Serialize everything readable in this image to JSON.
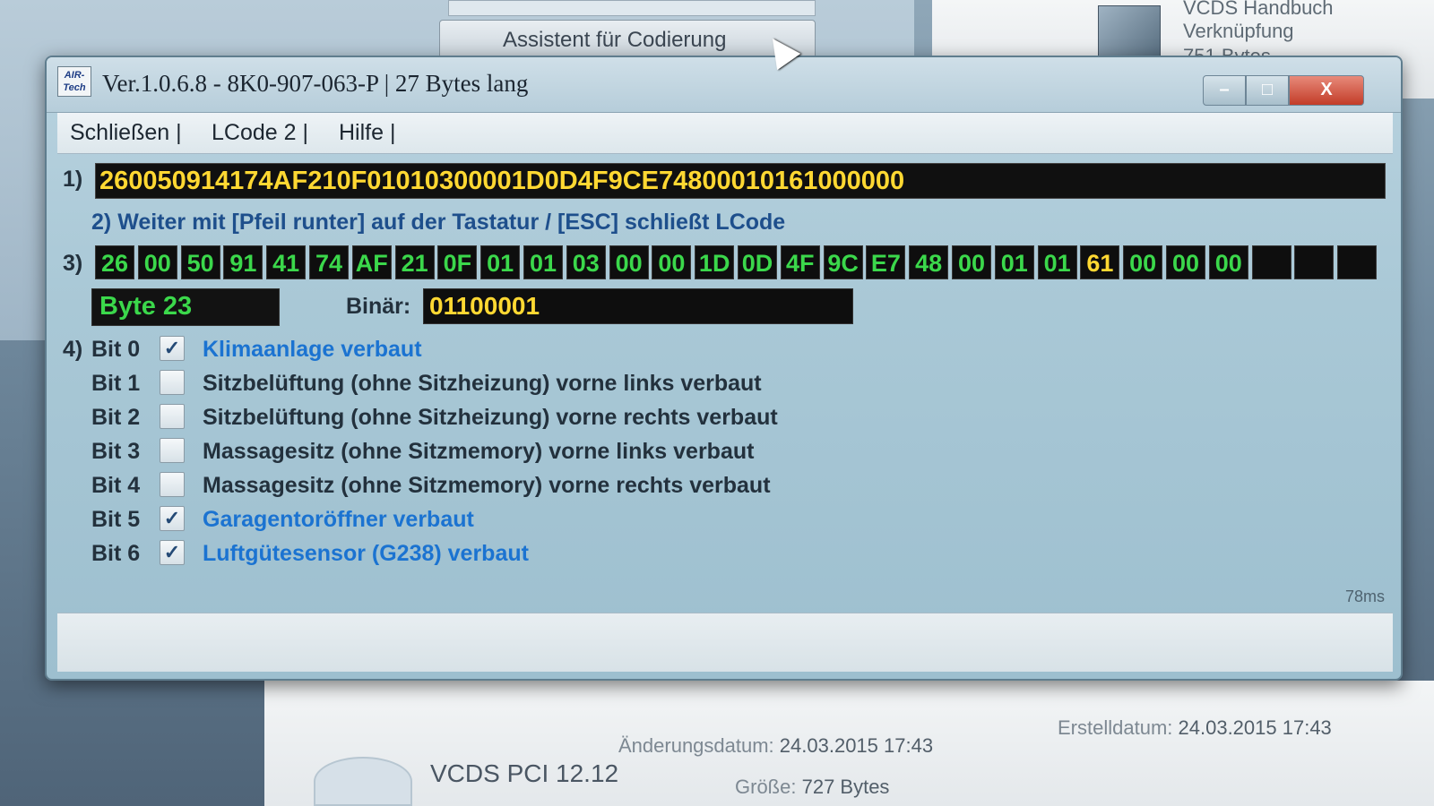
{
  "background": {
    "left_field_text": "Assistent für Codierung",
    "right_texts": [
      "VCDS Handbuch",
      "Verknüpfung",
      "751 Bytes"
    ],
    "bottom_title": "VCDS PCI 12.12",
    "bottom_change_label": "Änderungsdatum:",
    "bottom_change_value": "24.03.2015 17:43",
    "bottom_create_label": "Erstelldatum:",
    "bottom_create_value": "24.03.2015 17:43",
    "bottom_size_label": "Größe:",
    "bottom_size_value": "727 Bytes"
  },
  "window": {
    "icon_text": "AIR-Tech",
    "title": "Ver.1.0.6.8 -   8K0-907-063-P | 27 Bytes lang",
    "minimize": "–",
    "maximize": "□",
    "close": "X"
  },
  "menu": {
    "close": "Schließen |",
    "lcode2": "LCode 2 |",
    "help": "Hilfe |"
  },
  "rows": {
    "label1": "1)",
    "label2": "2)",
    "label3": "3)",
    "label4": "4)"
  },
  "code": "260050914174AF210F01010300001D0D4F9CE74800010161000000",
  "hint": "Weiter mit [Pfeil runter] auf der Tastatur / [ESC] schließt LCode",
  "bytes": [
    "26",
    "00",
    "50",
    "91",
    "41",
    "74",
    "AF",
    "21",
    "0F",
    "01",
    "01",
    "03",
    "00",
    "00",
    "1D",
    "0D",
    "4F",
    "9C",
    "E7",
    "48",
    "00",
    "01",
    "01",
    "61",
    "00",
    "00",
    "00",
    "",
    "",
    ""
  ],
  "selected_byte_index": 23,
  "byte_label": "Byte 23",
  "binar_label": "Binär:",
  "binar_value": "01100001",
  "bits": [
    {
      "name": "Bit 0",
      "checked": true,
      "desc": "Klimaanlage verbaut"
    },
    {
      "name": "Bit 1",
      "checked": false,
      "desc": "Sitzbelüftung (ohne Sitzheizung) vorne links verbaut"
    },
    {
      "name": "Bit 2",
      "checked": false,
      "desc": "Sitzbelüftung (ohne Sitzheizung) vorne rechts verbaut"
    },
    {
      "name": "Bit 3",
      "checked": false,
      "desc": "Massagesitz (ohne Sitzmemory) vorne links verbaut"
    },
    {
      "name": "Bit 4",
      "checked": false,
      "desc": "Massagesitz (ohne Sitzmemory) vorne rechts verbaut"
    },
    {
      "name": "Bit 5",
      "checked": true,
      "desc": "Garagentoröffner verbaut"
    },
    {
      "name": "Bit 6",
      "checked": true,
      "desc": "Luftgütesensor (G238) verbaut"
    }
  ],
  "status_time": "78ms",
  "icons": {
    "check": "✓"
  },
  "colors": {
    "code_yellow": "#ffd832",
    "byte_green": "#3bd84b",
    "active_blue": "#1b73d1"
  }
}
